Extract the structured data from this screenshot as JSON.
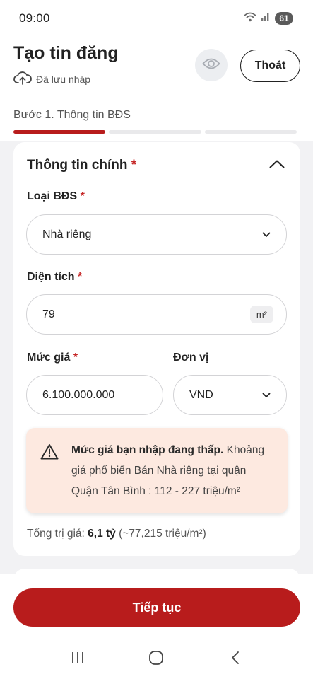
{
  "status_bar": {
    "time": "09:00",
    "battery": "61"
  },
  "header": {
    "title": "Tạo tin đăng",
    "draft_status": "Đã lưu nháp",
    "exit_label": "Thoát"
  },
  "step": {
    "label": "Bước 1. Thông tin BĐS",
    "current": 1,
    "total": 3
  },
  "section": {
    "title": "Thông tin chính",
    "required_mark": "*",
    "property_type": {
      "label": "Loại BĐS",
      "value": "Nhà riêng"
    },
    "area": {
      "label": "Diện tích",
      "value": "79",
      "unit": "m²"
    },
    "price": {
      "label": "Mức giá",
      "value": "6.100.000.000"
    },
    "price_unit": {
      "label": "Đơn vị",
      "value": "VND"
    },
    "warning": {
      "bold": "Mức giá bạn nhập đang thấp.",
      "text": " Khoảng giá phổ biến Bán Nhà riêng tại quận Quận Tân Bình : 112 - 227 triệu/m²"
    },
    "total": {
      "prefix": "Tổng trị giá: ",
      "value": "6,1 tỷ",
      "suffix": " (~77,215 triệu/m²)"
    }
  },
  "footer": {
    "continue_label": "Tiếp tục"
  },
  "colors": {
    "accent": "#b81c1c",
    "warning_bg": "#fde9e0",
    "content_bg": "#f2f2f4"
  },
  "icons": [
    "wifi-icon",
    "signal-icon",
    "battery-icon",
    "cloud-upload-icon",
    "eye-icon",
    "chevron-up-icon",
    "chevron-down-icon",
    "warning-icon",
    "recents-icon",
    "home-icon",
    "back-icon"
  ]
}
